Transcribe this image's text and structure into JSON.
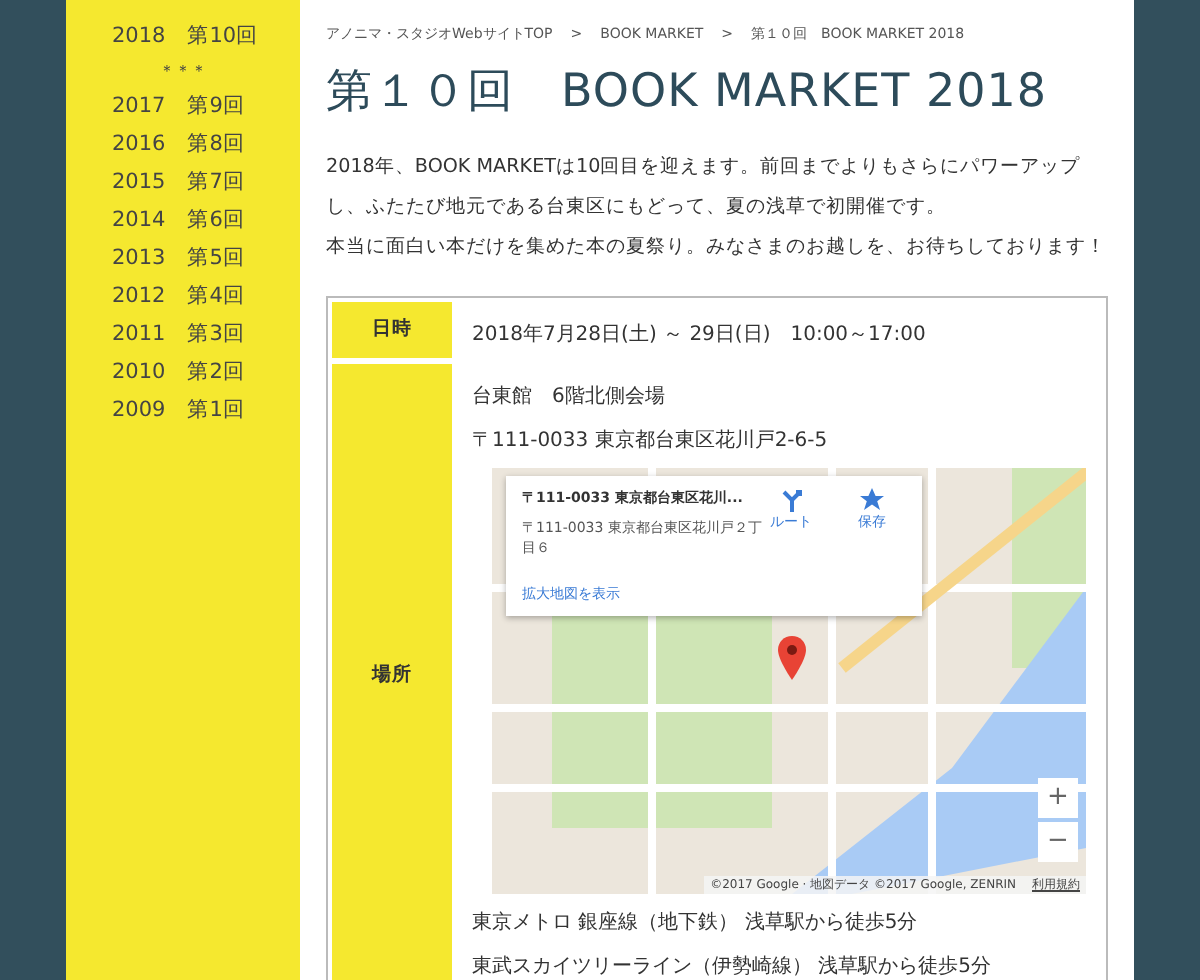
{
  "sidebar": {
    "items": [
      {
        "kind": "link",
        "year": "2018",
        "edition": "第10回"
      },
      {
        "kind": "separator",
        "text": "＊＊＊"
      },
      {
        "kind": "link",
        "year": "2017",
        "edition": "第9回"
      },
      {
        "kind": "link",
        "year": "2016",
        "edition": "第8回"
      },
      {
        "kind": "link",
        "year": "2015",
        "edition": "第7回"
      },
      {
        "kind": "link",
        "year": "2014",
        "edition": "第6回"
      },
      {
        "kind": "link",
        "year": "2013",
        "edition": "第5回"
      },
      {
        "kind": "link",
        "year": "2012",
        "edition": "第4回"
      },
      {
        "kind": "link",
        "year": "2011",
        "edition": "第3回"
      },
      {
        "kind": "link",
        "year": "2010",
        "edition": "第2回"
      },
      {
        "kind": "link",
        "year": "2009",
        "edition": "第1回"
      }
    ]
  },
  "breadcrumb": [
    {
      "label": "アノニマ・スタジオWebサイトTOP"
    },
    {
      "label": "BOOK MARKET"
    },
    {
      "label": "第１０回　BOOK MARKET 2018"
    }
  ],
  "breadcrumb_separator": ">",
  "title": "第１０回　BOOK MARKET 2018",
  "intro": [
    "2018年、BOOK MARKETは10回目を迎えます。前回までよりもさらにパワーアップし、ふたたび地元である台東区にもどって、夏の浅草で初開催です。",
    "本当に面白い本だけを集めた本の夏祭り。みなさまのお越しを、お待ちしております！"
  ],
  "table": {
    "rows": [
      {
        "header": "日時",
        "lines": [
          "2018年7月28日(土) ～ 29日(日)　10:00～17:00"
        ]
      },
      {
        "header": "場所",
        "lines": [
          "台東館　6階北側会場",
          "〒111-0033 東京都台東区花川戸2-6-5"
        ],
        "map": {
          "card_title": "〒111-0033 東京都台東区花川...",
          "card_address": "〒111-0033 東京都台東区花川戸２丁目６",
          "route": "ルート",
          "save": "保存",
          "enlarge": "拡大地図を表示",
          "zoom_in": "+",
          "zoom_out": "−",
          "attribution": "©2017 Google · 地図データ ©2017 Google, ZENRIN",
          "terms": "利用規約"
        },
        "after": [
          "東京メトロ 銀座線（地下鉄） 浅草駅から徒歩5分",
          "東武スカイツリーライン（伊勢崎線） 浅草駅から徒歩5分"
        ]
      }
    ]
  }
}
